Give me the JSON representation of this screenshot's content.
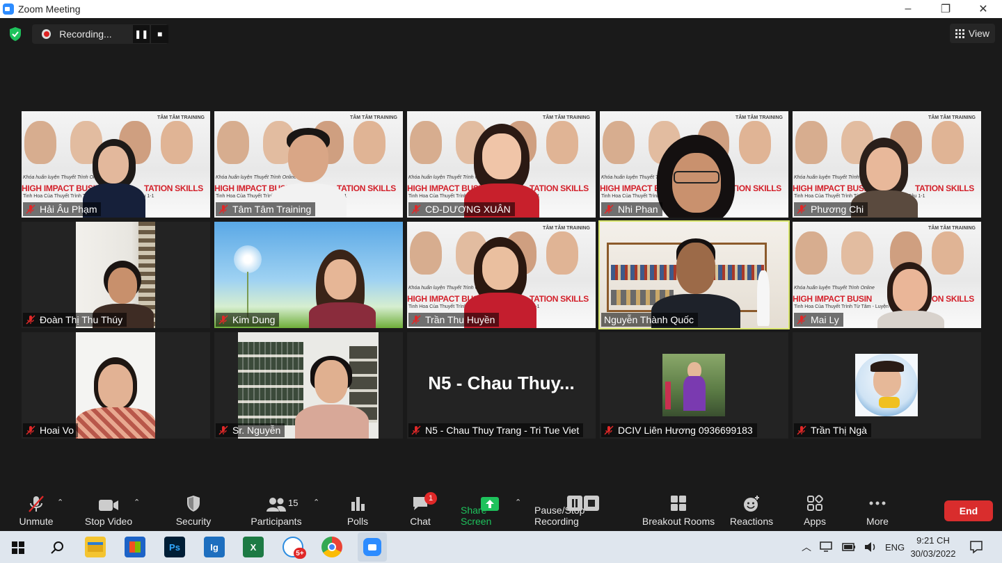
{
  "window": {
    "title": "Zoom Meeting",
    "minimize": "–",
    "maximize": "❐",
    "close": "✕"
  },
  "recording": {
    "label": "Recording...",
    "pause": "❚❚",
    "stop": "■"
  },
  "view_label": "View",
  "banner": {
    "logo": "TÂM TÂM TRAINING",
    "subtitle": "Khóa huấn luyện Thuyết Trình Online",
    "headline_left": "HIGH IMPACT BUSIN",
    "headline_right": "TATION SKILLS",
    "subline": "Tinh Hoa Của Thuyết Trình Từ Tâm - Luyện Chuyên Sâu 1-1"
  },
  "participants": [
    {
      "name": "Hải Âu Phạm"
    },
    {
      "name": "Tâm Tâm Training"
    },
    {
      "name": "CĐ-DƯƠNG XUÂN"
    },
    {
      "name": "Nhi Phan"
    },
    {
      "name": "Phương Chi"
    },
    {
      "name": "Đoàn Thị Thu Thúy"
    },
    {
      "name": "Kim Dung"
    },
    {
      "name": "Trần Thu Huyền"
    },
    {
      "name": "Nguyễn Thành Quốc"
    },
    {
      "name": "Mai Ly"
    },
    {
      "name": "Hoai Vo"
    },
    {
      "name": "Sr. Nguyễn"
    },
    {
      "name": "N5 - Chau Thuy Trang - Tri Tue Viet",
      "display_name": "N5  - Chau Thuy..."
    },
    {
      "name": "DCIV Liên Hương 0936699183"
    },
    {
      "name": "Trần Thị Ngà"
    }
  ],
  "toolbar": {
    "unmute": "Unmute",
    "stop_video": "Stop Video",
    "security": "Security",
    "participants": "Participants",
    "participants_count": "15",
    "polls": "Polls",
    "chat": "Chat",
    "chat_badge": "1",
    "share_screen": "Share Screen",
    "pause_stop_recording": "Pause/Stop Recording",
    "breakout_rooms": "Breakout Rooms",
    "reactions": "Reactions",
    "apps": "Apps",
    "more": "More",
    "end": "End",
    "caret": "⌃"
  },
  "taskbar": {
    "ps": "Ps",
    "ig": "Ig",
    "excel": "X",
    "zalo_badge": "5+",
    "lang": "ENG",
    "time": "9:21 CH",
    "date": "30/03/2022"
  },
  "colors": {
    "accent_green": "#1ec25c",
    "end_red": "#d92d2d",
    "active_speaker": "#d8e66a",
    "banner_red": "#d3202a"
  }
}
